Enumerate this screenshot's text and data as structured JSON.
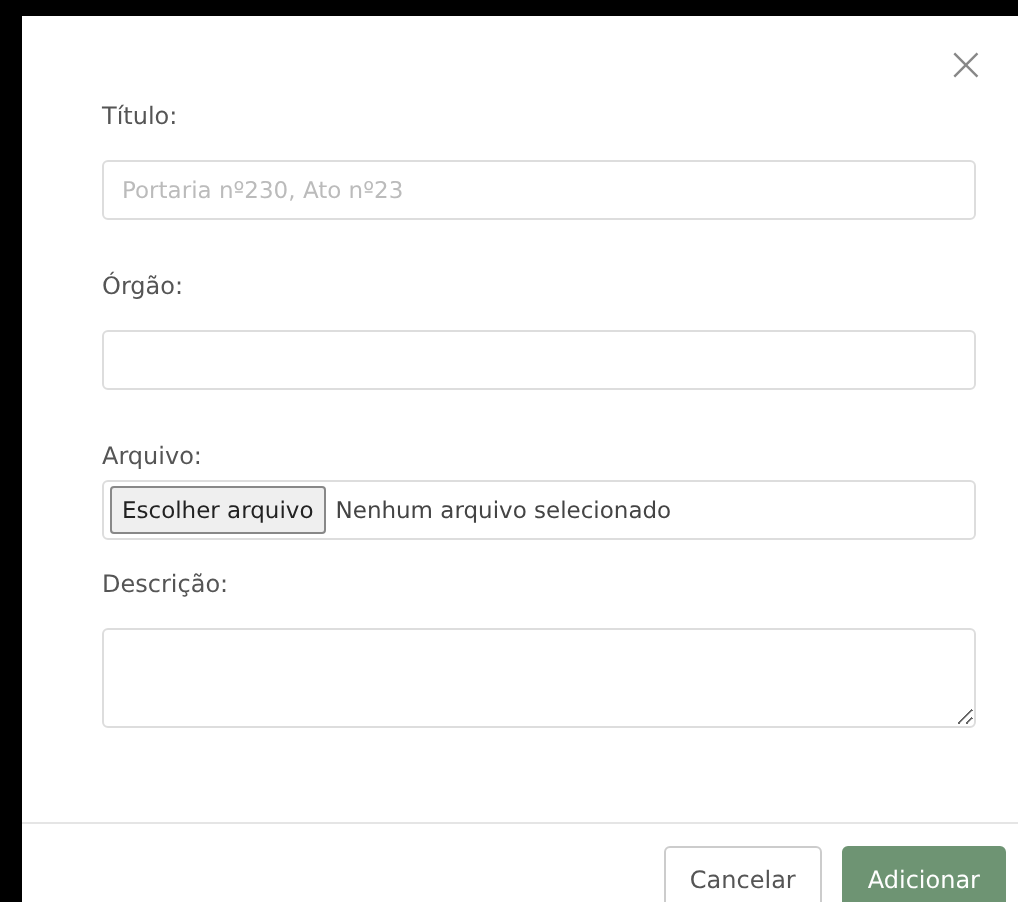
{
  "close_button": {
    "label": "×"
  },
  "fields": [
    {
      "kind": "text",
      "label": "Título:",
      "placeholder": "Portaria nº230, Ato nº23"
    },
    {
      "kind": "text",
      "label": "Órgão:"
    },
    {
      "kind": "file",
      "label": "Arquivo:",
      "button": "Escolher arquivo",
      "status": "Nenhum arquivo selecionado"
    },
    {
      "kind": "textarea",
      "label": "Descrição:"
    }
  ],
  "buttons": [
    {
      "label": "Cancelar",
      "kind": "secondary"
    },
    {
      "label": "Adicionar",
      "kind": "primary"
    }
  ]
}
